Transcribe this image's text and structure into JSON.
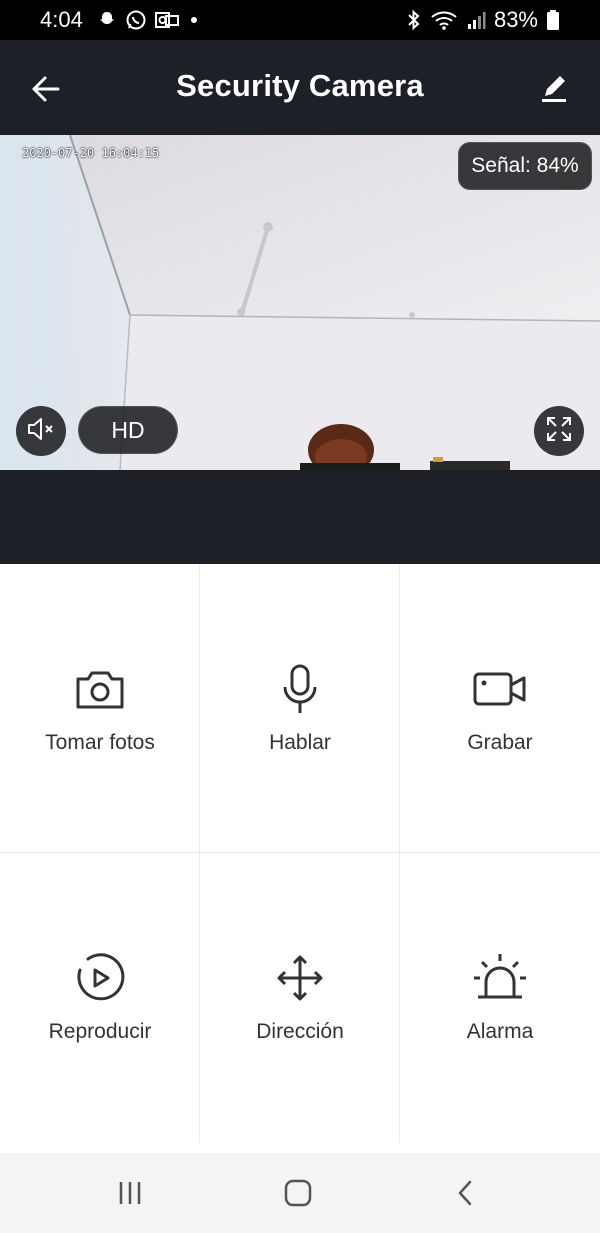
{
  "status_bar": {
    "time": "4:04",
    "battery": "83%",
    "left_icons": [
      "snapchat-icon",
      "whatsapp-icon",
      "outlook-icon",
      "dot-icon"
    ],
    "right_icons": [
      "bluetooth-icon",
      "wifi-icon",
      "signal-icon",
      "battery-icon"
    ]
  },
  "header": {
    "title": "Security Camera",
    "back_icon": "arrow-left-icon",
    "edit_icon": "pencil-icon"
  },
  "feed": {
    "timestamp": "2020-07-20 16:04:15",
    "signal_label": "Señal: 84%",
    "quality_label": "HD",
    "mute_icon": "volume-muted-icon",
    "fullscreen_icon": "fullscreen-icon"
  },
  "controls": [
    {
      "label": "Tomar fotos",
      "icon": "camera-icon"
    },
    {
      "label": "Hablar",
      "icon": "microphone-icon"
    },
    {
      "label": "Grabar",
      "icon": "video-camera-icon"
    },
    {
      "label": "Reproducir",
      "icon": "playback-icon"
    },
    {
      "label": "Dirección",
      "icon": "move-arrows-icon"
    },
    {
      "label": "Alarma",
      "icon": "alarm-siren-icon"
    }
  ],
  "nav_bar": {
    "recents_icon": "recents-icon",
    "home_icon": "home-icon",
    "back_icon": "nav-back-icon"
  },
  "colors": {
    "header_bg": "#1e2028",
    "status_bg": "#000000",
    "text": "#333333"
  }
}
